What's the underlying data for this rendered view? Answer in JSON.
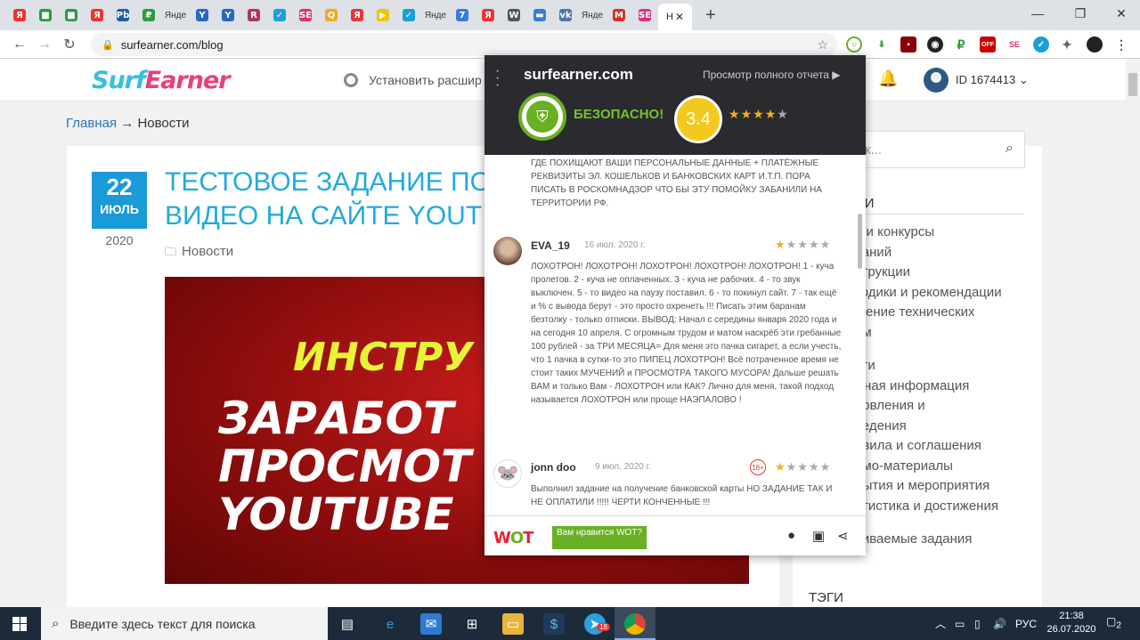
{
  "browser": {
    "tabs": [
      {
        "icon": "yandex-icon",
        "glyph": "Я",
        "color": "#e33"
      },
      {
        "icon": "wallet-icon",
        "glyph": "■",
        "color": "#2a9d3f"
      },
      {
        "icon": "wallet-icon",
        "glyph": "■",
        "color": "#2a9d3f"
      },
      {
        "icon": "yandex-icon",
        "glyph": "Я",
        "color": "#e33"
      },
      {
        "icon": "pb-icon",
        "glyph": "Pb",
        "color": "#1b5e9e"
      },
      {
        "icon": "ruble-icon",
        "glyph": "₽",
        "color": "#2a9d3f"
      },
      {
        "icon": "text",
        "glyph": "Янде"
      },
      {
        "icon": "y-icon",
        "glyph": "Y",
        "color": "#2a66c4"
      },
      {
        "icon": "y-icon",
        "glyph": "Y",
        "color": "#2a66c4"
      },
      {
        "icon": "r-icon",
        "glyph": "R",
        "color": "#b0336a"
      },
      {
        "icon": "check-icon",
        "glyph": "✓",
        "color": "#1aa0d8"
      },
      {
        "icon": "se-icon",
        "glyph": "SE",
        "color": "#d9317a"
      },
      {
        "icon": "q-icon",
        "glyph": "Q",
        "color": "#f5a623"
      },
      {
        "icon": "yandex-icon",
        "glyph": "Я",
        "color": "#e33"
      },
      {
        "icon": "play-icon",
        "glyph": "▶",
        "color": "#f5c400"
      },
      {
        "icon": "check-icon",
        "glyph": "✓",
        "color": "#1aa0d8"
      },
      {
        "icon": "text",
        "glyph": "Янде"
      },
      {
        "icon": "seven-icon",
        "glyph": "7",
        "color": "#3a7bd5"
      },
      {
        "icon": "yandex-icon",
        "glyph": "Я",
        "color": "#e33"
      },
      {
        "icon": "wiki-icon",
        "glyph": "W",
        "color": "#555"
      },
      {
        "icon": "chat-icon",
        "glyph": "▬",
        "color": "#3a7bd5"
      },
      {
        "icon": "vk-icon",
        "glyph": "vk",
        "color": "#4a76a8"
      },
      {
        "icon": "text",
        "glyph": "Янде"
      },
      {
        "icon": "gmail-icon",
        "glyph": "M",
        "color": "#d93025"
      },
      {
        "icon": "se-icon",
        "glyph": "SE",
        "color": "#d9317a"
      }
    ],
    "active_tab_label": "Н",
    "active_tab_close": "✕",
    "new_tab": "+",
    "url": "surfearner.com/blog"
  },
  "site": {
    "logo_main": "Surf",
    "logo_accent": "Earner",
    "install_text": "Установить расшир",
    "user_id": "ID 1674413",
    "breadcrumb_home": "Главная",
    "breadcrumb_arrow": "→",
    "breadcrumb_current": "Новости",
    "post_day": "22",
    "post_month": "ИЮЛЬ",
    "post_year": "2020",
    "post_title_1": "ТЕСТОВОЕ ЗАДАНИЕ ПО",
    "post_title_2": "ВИДЕО НА САЙТЕ YOUT",
    "post_category": "Новости",
    "banner_line1": "ИНСТРУ",
    "banner_line2": "ЗАРАБОТ",
    "banner_line3": "ПРОСМОТ",
    "banner_line4": "YOUTUBE",
    "search_placeholder": "к...",
    "sidebar_heading": "ИИ",
    "sidebar_links": [
      "и и конкурсы",
      "ваний",
      "струкции",
      "тодики и рекомендации",
      "шение технических",
      "ем",
      "сти",
      "жная информация",
      "новления и",
      "ведения",
      "авила и соглашения",
      "омо-материалы",
      "бытия и мероприятия",
      "атистика и достижения",
      "чиваемые задания"
    ],
    "tags_heading": "ТЭГИ"
  },
  "wot": {
    "site": "surfearner.com",
    "report_link": "Просмотр полного отчета ▶",
    "status": "БЕЗОПАСНО!",
    "score": "3.4",
    "stars": [
      true,
      true,
      true,
      true,
      false
    ],
    "review0_text": "ГДЕ ПОХИЩАЮТ ВАШИ ПЕРСОНАЛЬНЫЕ ДАННЫЕ + ПЛАТЁЖНЫЕ РЕКВИЗИТЫ ЭЛ. КОШЕЛЬКОВ И БАНКОВСКИХ КАРТ И.Т.П. ПОРА ПИСАТЬ В РОСКОМНАДЗОР ЧТО БЫ ЭТУ ПОМОЙКУ ЗАБАНИЛИ НА ТЕРРИТОРИИ РФ.",
    "review1_name": "EVA_19",
    "review1_date": "16 июл. 2020 г.",
    "review1_text": "ЛОХОТРОН! ЛОХОТРОН! ЛОХОТРОН! ЛОХОТРОН! ЛОХОТРОН! 1 - куча пролетов. 2 - куча не оплаченных. 3 - куча не рабочих. 4 - то звук выключен. 5 - то видео на паузу поставил. 6 - то покинул сайт. 7 - так ещё и % с вывода берут - это просто охренеть !!! Писать этим баранам безтолку - только отписки. ВЫВОД: Начал с середины января 2020 года и на сегодня 10 апреля. С огромным трудом и матом наскрёб эти гребанные 100 рублей - за ТРИ МЕСЯЦА= Для меня это пачка сигарет, а если учесть, что 1 пачка в сутки-то это ПИПЕЦ ЛОХОТРОН! Всё потраченное время не стоит таких МУЧЕНИЙ и ПРОСМОТРА ТАКОГО МУСОРА! Дальше решать ВАМ и только Вам - ЛОХОТРОН или КАК? Лично для меня, такой подход называется ЛОХОТРОН или проще НАЭПАЛОВО !",
    "review2_name": "jonn doo",
    "review2_date": "9 июл. 2020 г.",
    "review2_badge": "18+",
    "review2_text": "Выполнил задание на получение банковской карты НО ЗАДАНИЕ ТАК И НЕ ОПЛАТИЛИ !!!!! ЧЕРТИ КОНЧЕННЫЕ !!!",
    "footer_logo_w": "W",
    "footer_logo_o": "O",
    "footer_logo_t": "T",
    "like_button": "Вам нравится WOT?"
  },
  "taskbar": {
    "search_placeholder": "Введите здесь текст для поиска",
    "language": "РУС",
    "time": "21:38",
    "date": "26.07.2020",
    "notification_count": "2",
    "telegram_badge": "18"
  }
}
